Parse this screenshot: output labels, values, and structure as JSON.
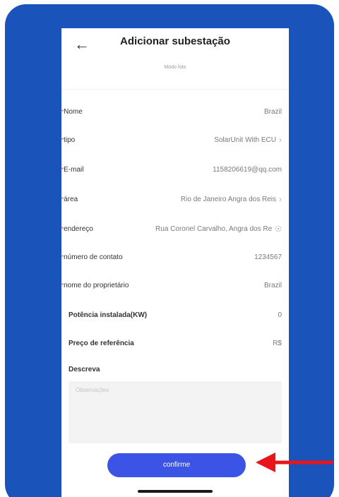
{
  "header": {
    "back_icon": "back-arrow-icon",
    "title": "Adicionar subestação",
    "subtitle": "Modo foto"
  },
  "fields": [
    {
      "label": "Nome",
      "value": "Brazil",
      "required": true
    },
    {
      "label": "tipo",
      "value": "SolarUnit With ECU",
      "required": true,
      "chevron": true
    },
    {
      "label": "E-mail",
      "value": "1158206619@qq.com",
      "required": true
    },
    {
      "label": "área",
      "value": "Rio de Janeiro Angra dos Reis",
      "required": true,
      "chevron": true
    },
    {
      "label": "endereço",
      "value": "Rua Coronel Carvalho, Angra dos Re",
      "required": true,
      "pin": true
    },
    {
      "label": "número de contato",
      "value": "1234567",
      "required": true
    },
    {
      "label": "nome do proprietário",
      "value": "Brazil",
      "required": true
    }
  ],
  "extra_fields": [
    {
      "label": "Potência instalada(KW)",
      "value": "0"
    },
    {
      "label": "Preço de referência",
      "value": "R$"
    }
  ],
  "description": {
    "label": "Descreva",
    "placeholder": "Observações"
  },
  "confirm_label": "confirme",
  "colors": {
    "background_blue": "#1a53b9",
    "button_blue": "#3b54e6",
    "arrow_red": "#e8161b"
  }
}
